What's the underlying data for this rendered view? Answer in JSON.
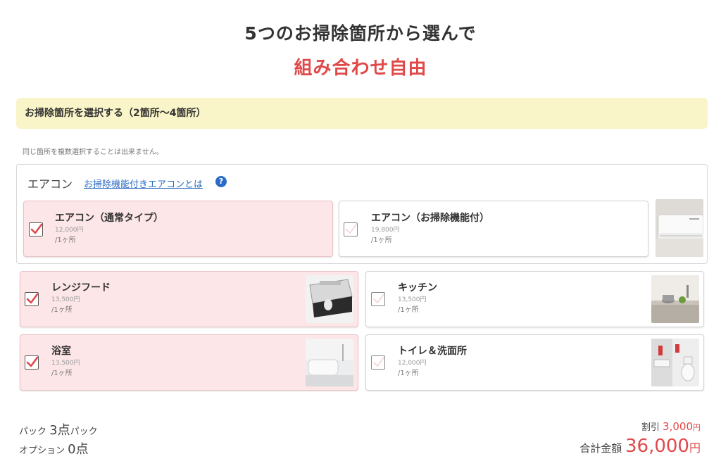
{
  "header": {
    "title_line1": "5つのお掃除箇所から選んで",
    "title_line2": "組み合わせ自由"
  },
  "section": {
    "heading": "お掃除箇所を選択する（2箇所〜4箇所）",
    "note": "同じ箇所を複数選択することは出来ません。"
  },
  "aircon": {
    "label": "エアコン",
    "link_text": "お掃除機能付きエアコンとは",
    "help_icon": "?"
  },
  "cards": [
    {
      "name": "エアコン（通常タイプ）",
      "price": "12,000円",
      "unit": "/1ヶ所",
      "selected": true,
      "icon": "checkbox-checked"
    },
    {
      "name": "エアコン（お掃除機能付）",
      "price": "19,800円",
      "unit": "/1ヶ所",
      "selected": false,
      "icon": "checkbox-empty"
    },
    {
      "name": "レンジフード",
      "price": "13,500円",
      "unit": "/1ヶ所",
      "selected": true,
      "icon": "checkbox-checked"
    },
    {
      "name": "キッチン",
      "price": "13,500円",
      "unit": "/1ヶ所",
      "selected": false,
      "icon": "checkbox-empty"
    },
    {
      "name": "浴室",
      "price": "13,500円",
      "unit": "/1ヶ所",
      "selected": true,
      "icon": "checkbox-checked"
    },
    {
      "name": "トイレ＆洗面所",
      "price": "12,000円",
      "unit": "/1ヶ所",
      "selected": false,
      "icon": "checkbox-empty"
    }
  ],
  "summary": {
    "pack_label": "パック",
    "pack_value": "3点",
    "pack_suffix": "パック",
    "option_label": "オプション",
    "option_value": "0点",
    "discount_label": "割引",
    "discount_value": "3,000",
    "discount_unit": "円",
    "total_label": "合計金額",
    "total_value": "36,000",
    "total_unit": "円"
  },
  "colors": {
    "accent_red": "#e0494a",
    "selected_bg": "#fde6e8",
    "band_bg": "#faf5c8",
    "link_blue": "#2b6cc4"
  }
}
